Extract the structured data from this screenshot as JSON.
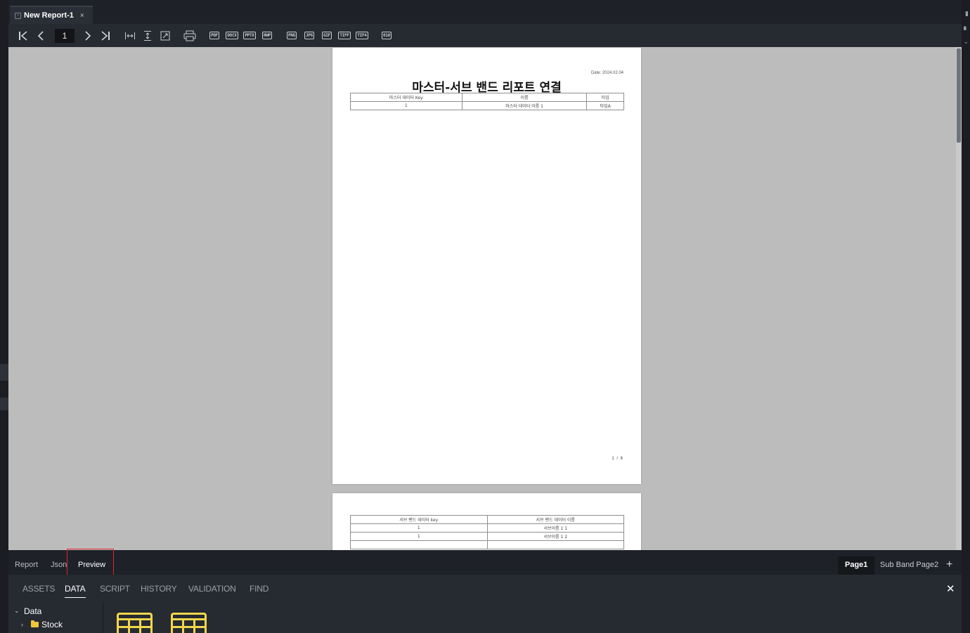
{
  "document_tab": {
    "title": "New Report-1",
    "close": "×"
  },
  "toolbar": {
    "page_number": "1",
    "export_formats": [
      "PDF",
      "DOCX",
      "PPTX",
      "HWP",
      "PNG",
      "JPG",
      "GIF",
      "TIFF",
      "TIF4"
    ],
    "extra_icon_label": "010"
  },
  "report": {
    "page1": {
      "date": "Date: 2024.02.04",
      "title": "마스터-서브 밴드 리포트 연결",
      "table": {
        "headers": [
          "마스터 데이터 Key",
          "이름",
          "타입"
        ],
        "rows": [
          [
            "1",
            "마스터 데이터 이름 1",
            "타입A"
          ]
        ]
      },
      "page_counter": "1 / 6"
    },
    "page2": {
      "table": {
        "headers": [
          "서브 밴드 데이터 key",
          "서브 밴드 데이터 이름"
        ],
        "rows": [
          [
            "1",
            "서브이름 1 1"
          ],
          [
            "1",
            "서브이름 1 2"
          ],
          [
            "",
            ""
          ]
        ]
      }
    }
  },
  "view_tabs": {
    "report": "Report",
    "json": "Json",
    "preview": "Preview"
  },
  "page_tabs": {
    "page1": "Page1",
    "page2": "Sub Band Page2",
    "add": "+"
  },
  "panel": {
    "tabs": {
      "assets": "ASSETS",
      "data": "DATA",
      "script": "SCRIPT",
      "history": "HISTORY",
      "validation": "VALIDATION",
      "find": "FIND"
    },
    "close": "✕",
    "tree": {
      "root": "Data",
      "child": "Stock"
    }
  },
  "colors": {
    "accent_highlight": "#e5242b",
    "folder": "#f0c53c",
    "table_icon": "#f2d64b"
  }
}
